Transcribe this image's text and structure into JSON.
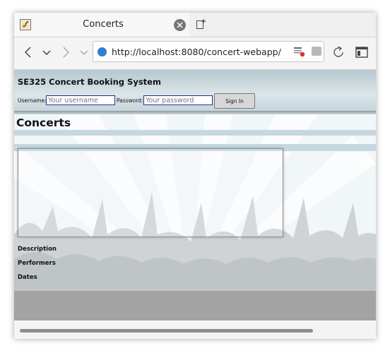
{
  "tab": {
    "title": "Concerts",
    "favicon": "guitar-favicon-icon"
  },
  "url": "http://localhost:8080/concert-webapp/",
  "header": {
    "title": "SE325 Concert Booking System",
    "username_label": "Username:",
    "username_placeholder": "Your username",
    "password_label": "Password:",
    "password_placeholder": "Your password",
    "signin_label": "Sign In"
  },
  "main": {
    "title": "Concerts",
    "details": [
      "Description",
      "Performers",
      "Dates"
    ]
  },
  "colors": {
    "header": "#c9d8de",
    "footer": "#a3a3a3",
    "link_blue": "#2f80d1"
  }
}
